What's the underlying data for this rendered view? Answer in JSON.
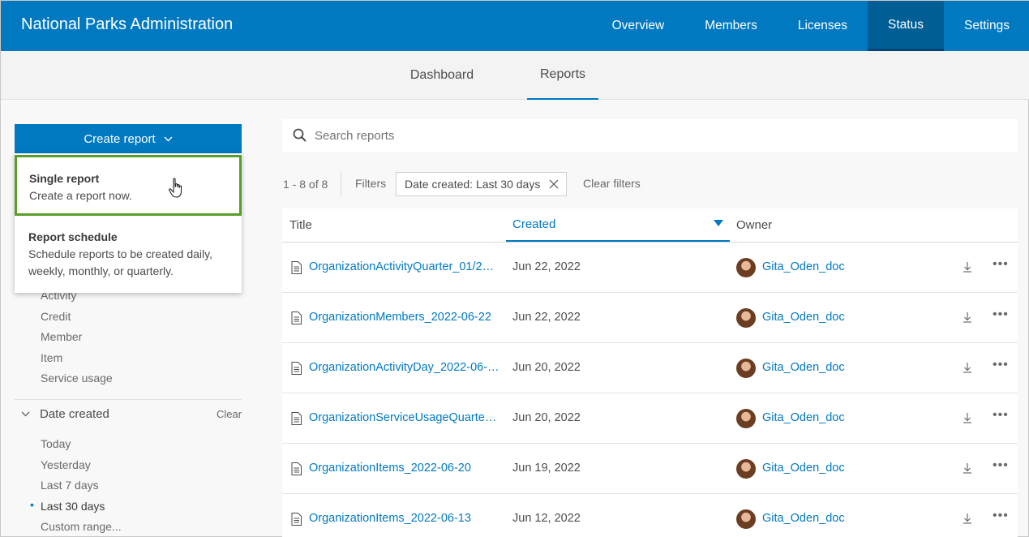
{
  "header": {
    "brand": "National Parks Administration",
    "nav": [
      "Overview",
      "Members",
      "Licenses",
      "Status",
      "Settings"
    ],
    "active_nav": "Status"
  },
  "subtabs": {
    "dashboard": "Dashboard",
    "reports": "Reports",
    "active": "Reports"
  },
  "sidebar": {
    "create_button": "Create report",
    "dropdown": {
      "single": {
        "title": "Single report",
        "desc": "Create a report now."
      },
      "schedule": {
        "title": "Report schedule",
        "desc": "Schedule reports to be created daily, weekly, monthly, or quarterly."
      }
    },
    "type_items": [
      "Activity",
      "Credit",
      "Member",
      "Item",
      "Service usage"
    ],
    "date_section": {
      "title": "Date created",
      "clear": "Clear"
    },
    "date_items": [
      "Today",
      "Yesterday",
      "Last 7 days",
      "Last 30 days",
      "Custom range..."
    ],
    "selected_date": "Last 30 days",
    "bullet": "•"
  },
  "main": {
    "search_placeholder": "Search reports",
    "count": "1 - 8 of 8",
    "filters_label": "Filters",
    "filter_chip": "Date created: Last 30 days",
    "clear_filters": "Clear filters",
    "columns": {
      "title": "Title",
      "created": "Created",
      "owner": "Owner"
    },
    "rows": [
      {
        "title": "OrganizationActivityQuarter_01/2…",
        "date": "Jun 22, 2022",
        "owner": "Gita_Oden_doc"
      },
      {
        "title": "OrganizationMembers_2022-06-22",
        "date": "Jun 22, 2022",
        "owner": "Gita_Oden_doc"
      },
      {
        "title": "OrganizationActivityDay_2022-06-…",
        "date": "Jun 20, 2022",
        "owner": "Gita_Oden_doc"
      },
      {
        "title": "OrganizationServiceUsageQuarter…",
        "date": "Jun 20, 2022",
        "owner": "Gita_Oden_doc"
      },
      {
        "title": "OrganizationItems_2022-06-20",
        "date": "Jun 19, 2022",
        "owner": "Gita_Oden_doc"
      },
      {
        "title": "OrganizationItems_2022-06-13",
        "date": "Jun 12, 2022",
        "owner": "Gita_Oden_doc"
      }
    ]
  },
  "colors": {
    "brand_blue": "#0079c1",
    "active_nav": "#005e95",
    "focus_green": "#5a9e2a"
  }
}
